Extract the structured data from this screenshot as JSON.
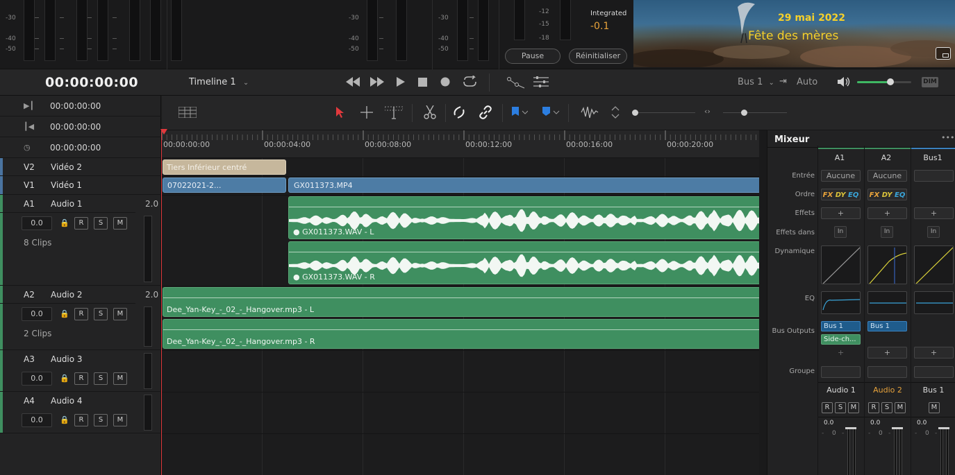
{
  "meters": {
    "scale_left": [
      "-30",
      "-40",
      "-50"
    ],
    "scale_mid": [
      "-30",
      "-40",
      "-50"
    ],
    "scale_right": [
      "-30",
      "-40",
      "-50"
    ],
    "scale_loud": [
      "-12",
      "-15",
      "-18"
    ]
  },
  "loudness": {
    "label": "Integrated",
    "value": "-0.1",
    "pause_label": "Pause",
    "reset_label": "Réinitialiser"
  },
  "viewer": {
    "date_text": "29 mai  2022",
    "caption_text": "Fête des mères"
  },
  "transport": {
    "timecode": "00:00:00:00",
    "timeline_name": "Timeline 1",
    "bus_select": "Bus 1",
    "auto_label": "Auto",
    "dim_label": "DIM",
    "volume_level": 0.62
  },
  "timecodes": {
    "in": "00:00:00:00",
    "out": "00:00:00:00",
    "duration": "00:00:00:00"
  },
  "tracks": {
    "v2": {
      "id": "V2",
      "name": "Vidéo 2"
    },
    "v1": {
      "id": "V1",
      "name": "Vidéo 1"
    },
    "a1": {
      "id": "A1",
      "name": "Audio 1",
      "channels": "2.0",
      "volume": "0.0",
      "clips": "8 Clips"
    },
    "a2": {
      "id": "A2",
      "name": "Audio 2",
      "channels": "2.0",
      "volume": "0.0",
      "clips": "2 Clips"
    },
    "a3": {
      "id": "A3",
      "name": "Audio 3",
      "volume": "0.0"
    },
    "a4": {
      "id": "A4",
      "name": "Audio 4",
      "volume": "0.0"
    },
    "rsm": [
      "R",
      "S",
      "M"
    ]
  },
  "ruler": [
    "00:00:00:00",
    "00:00:04:00",
    "00:00:08:00",
    "00:00:12:00",
    "00:00:16:00",
    "00:00:20:00"
  ],
  "clips": {
    "title_clip": "Tiers Inférieur centré",
    "v1_clip_a": "07022021-2...",
    "v1_clip_b": "GX011373.MP4",
    "a1_left": "GX011373.WAV - L",
    "a1_right": "GX011373.WAV - R",
    "a2_left": "Dee_Yan-Key_-_02_-_Hangover.mp3 - L",
    "a2_right": "Dee_Yan-Key_-_02_-_Hangover.mp3 - R"
  },
  "mixer": {
    "title": "Mixeur",
    "more": "•••",
    "columns": [
      "A1",
      "A2",
      "Bus1"
    ],
    "row_labels": {
      "input": "Entrée",
      "order": "Ordre",
      "effects": "Effets",
      "effects_in": "Effets dans",
      "dynamics": "Dynamique",
      "eq": "EQ",
      "bus_outputs": "Bus Outputs",
      "group": "Groupe"
    },
    "input_values": [
      "Aucune",
      "Aucune"
    ],
    "order": {
      "fx": "FX",
      "dy": "DY",
      "eq": "EQ"
    },
    "plus": "+",
    "effects_in_symbol": "In",
    "bus_outputs": {
      "a1": [
        "Bus 1",
        "Side-ch..."
      ],
      "a2": [
        "Bus 1"
      ]
    },
    "strip_names": [
      "Audio 1",
      "Audio 2",
      "Bus 1"
    ],
    "strip_name_colors": [
      "#dcdcdc",
      "#e8a33b",
      "#dcdcdc"
    ],
    "strip_rsm": [
      "R",
      "S",
      "M"
    ],
    "bus_m": "M",
    "fader_values": [
      "0.0",
      "0.0",
      "0.0"
    ],
    "fader_zero": "0",
    "fader_dash": "-"
  },
  "colors": {
    "accent_green": "#3f8f60",
    "video_blue": "#4d7ca5",
    "title_tan": "#c6b79c",
    "playhead_red": "#e2393d",
    "loudness_orange": "#e8a33b"
  }
}
